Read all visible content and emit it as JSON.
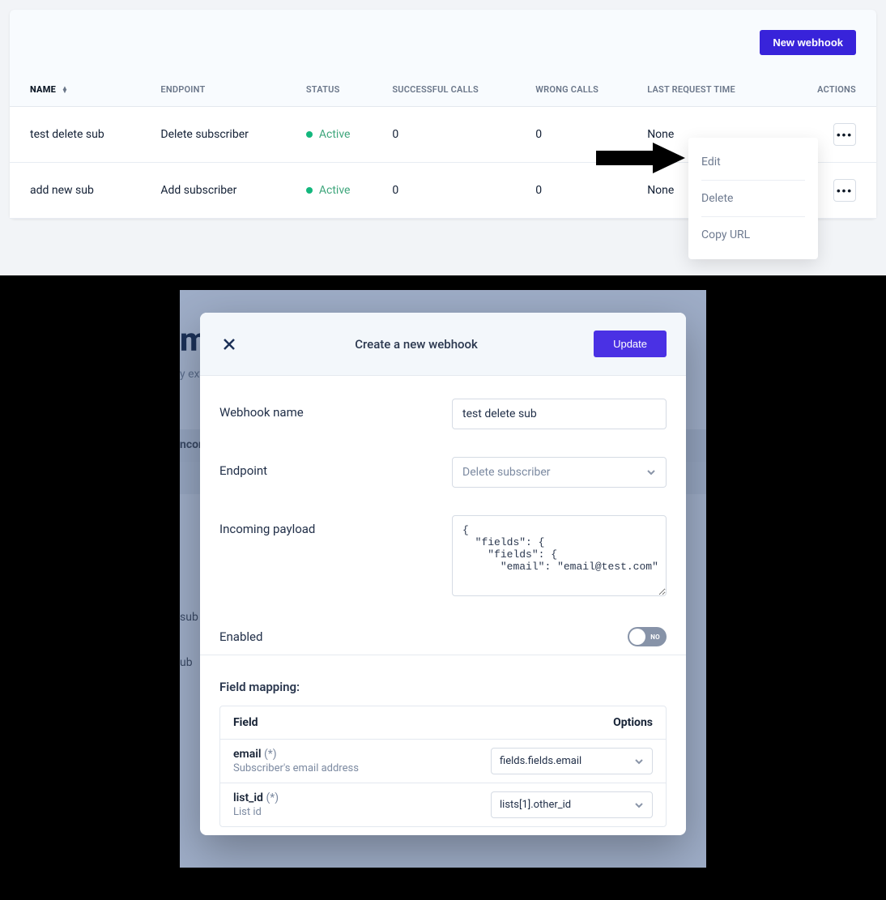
{
  "top": {
    "new_webhook_label": "New webhook",
    "columns": {
      "name": "NAME",
      "endpoint": "ENDPOINT",
      "status": "STATUS",
      "successful": "SUCCESSFUL CALLS",
      "wrong": "WRONG CALLS",
      "last_request": "LAST REQUEST TIME",
      "actions": "ACTIONS"
    },
    "rows": [
      {
        "name": "test delete sub",
        "endpoint": "Delete subscriber",
        "status": "Active",
        "successful": "0",
        "wrong": "0",
        "last_request": "None"
      },
      {
        "name": "add new sub",
        "endpoint": "Add subscriber",
        "status": "Active",
        "successful": "0",
        "wrong": "0",
        "last_request": "None"
      }
    ],
    "menu": {
      "edit": "Edit",
      "delete": "Delete",
      "copy_url": "Copy URL"
    }
  },
  "bg": {
    "title_fragment": "mi",
    "subtitle_fragment": "y ext",
    "tab_fragment": "ncom",
    "row1_fragment": " sub",
    "row2_fragment": "ub"
  },
  "modal": {
    "title": "Create a new webhook",
    "update_label": "Update",
    "fields": {
      "name_label": "Webhook name",
      "name_value": "test delete sub",
      "endpoint_label": "Endpoint",
      "endpoint_value": "Delete subscriber",
      "payload_label": "Incoming payload",
      "payload_value": "{\n  \"fields\": {\n    \"fields\": {\n      \"email\": \"email@test.com\"",
      "enabled_label": "Enabled",
      "enabled_toggle": "NO"
    },
    "mapping": {
      "section_title": "Field mapping:",
      "col_field": "Field",
      "col_options": "Options",
      "rows": [
        {
          "name": "email",
          "required": "(*)",
          "desc": "Subscriber's email address",
          "option": "fields.fields.email"
        },
        {
          "name": "list_id",
          "required": "(*)",
          "desc": "List id",
          "option": "lists[1].other_id"
        }
      ]
    }
  }
}
